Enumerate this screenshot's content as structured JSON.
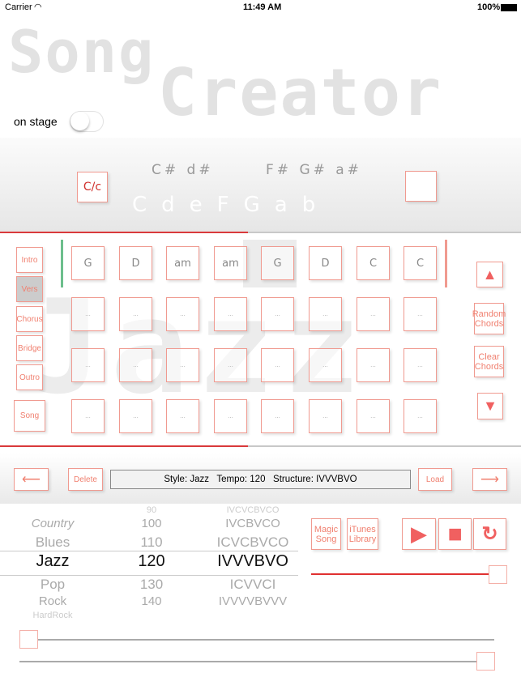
{
  "status_bar": {
    "carrier": "Carrier",
    "time": "11:49 AM",
    "battery": "100%"
  },
  "logo": {
    "line1": "Song",
    "line2": "Creator"
  },
  "on_stage": {
    "label": "on stage",
    "enabled": false
  },
  "keys": {
    "toggle_label": "C/c",
    "sharps": [
      "C#",
      "d#",
      "F#",
      "G#",
      "a#"
    ],
    "naturals": [
      "C",
      "d",
      "e",
      "F",
      "G",
      "a",
      "b"
    ]
  },
  "sections": [
    "Intro",
    "Vers",
    "Chorus",
    "Bridge",
    "Outro"
  ],
  "selected_section": "Vers",
  "song_button": "Song",
  "background_style_word": "Jazz",
  "chord_rows": [
    [
      "G",
      "D",
      "am",
      "am",
      "G",
      "D",
      "C",
      "C"
    ],
    [
      "...",
      "...",
      "...",
      "...",
      "...",
      "...",
      "...",
      "..."
    ],
    [
      "...",
      "...",
      "...",
      "...",
      "...",
      "...",
      "...",
      "..."
    ],
    [
      "...",
      "...",
      "...",
      "...",
      "...",
      "...",
      "...",
      "..."
    ]
  ],
  "right_buttons": {
    "up": "▲",
    "random": "Random Chords",
    "clear": "Clear Chords",
    "down": "▼"
  },
  "toolbar": {
    "back": "⟵",
    "delete": "Delete",
    "info": "Style: Jazz   Tempo: 120   Structure: IVVVBVO",
    "load": "Load",
    "forward": "⟶"
  },
  "picker": {
    "rows": [
      {
        "style": "",
        "tempo": "90",
        "structure": "IVCVCBVCO"
      },
      {
        "style": "Country",
        "tempo": "100",
        "structure": "IVCBVCO"
      },
      {
        "style": "Blues",
        "tempo": "110",
        "structure": "ICVCBVCO"
      },
      {
        "style": "Jazz",
        "tempo": "120",
        "structure": "IVVVBVO"
      },
      {
        "style": "Pop",
        "tempo": "130",
        "structure": "ICVVCI"
      },
      {
        "style": "Rock",
        "tempo": "140",
        "structure": "IVVVVBVVV"
      },
      {
        "style": "HardRock",
        "tempo": "",
        "structure": ""
      }
    ],
    "selected_index": 3
  },
  "actions": {
    "magic": "Magic Song",
    "itunes": "iTunes Library",
    "play": "▶",
    "stop": "■",
    "repeat": "↻"
  },
  "sliders": {
    "volume": 1.0,
    "slider1": 0.0,
    "slider2": 1.0
  },
  "colors": {
    "accent": "#f08070",
    "red_line": "#d9393b",
    "green_marker": "#6dbf8c"
  }
}
